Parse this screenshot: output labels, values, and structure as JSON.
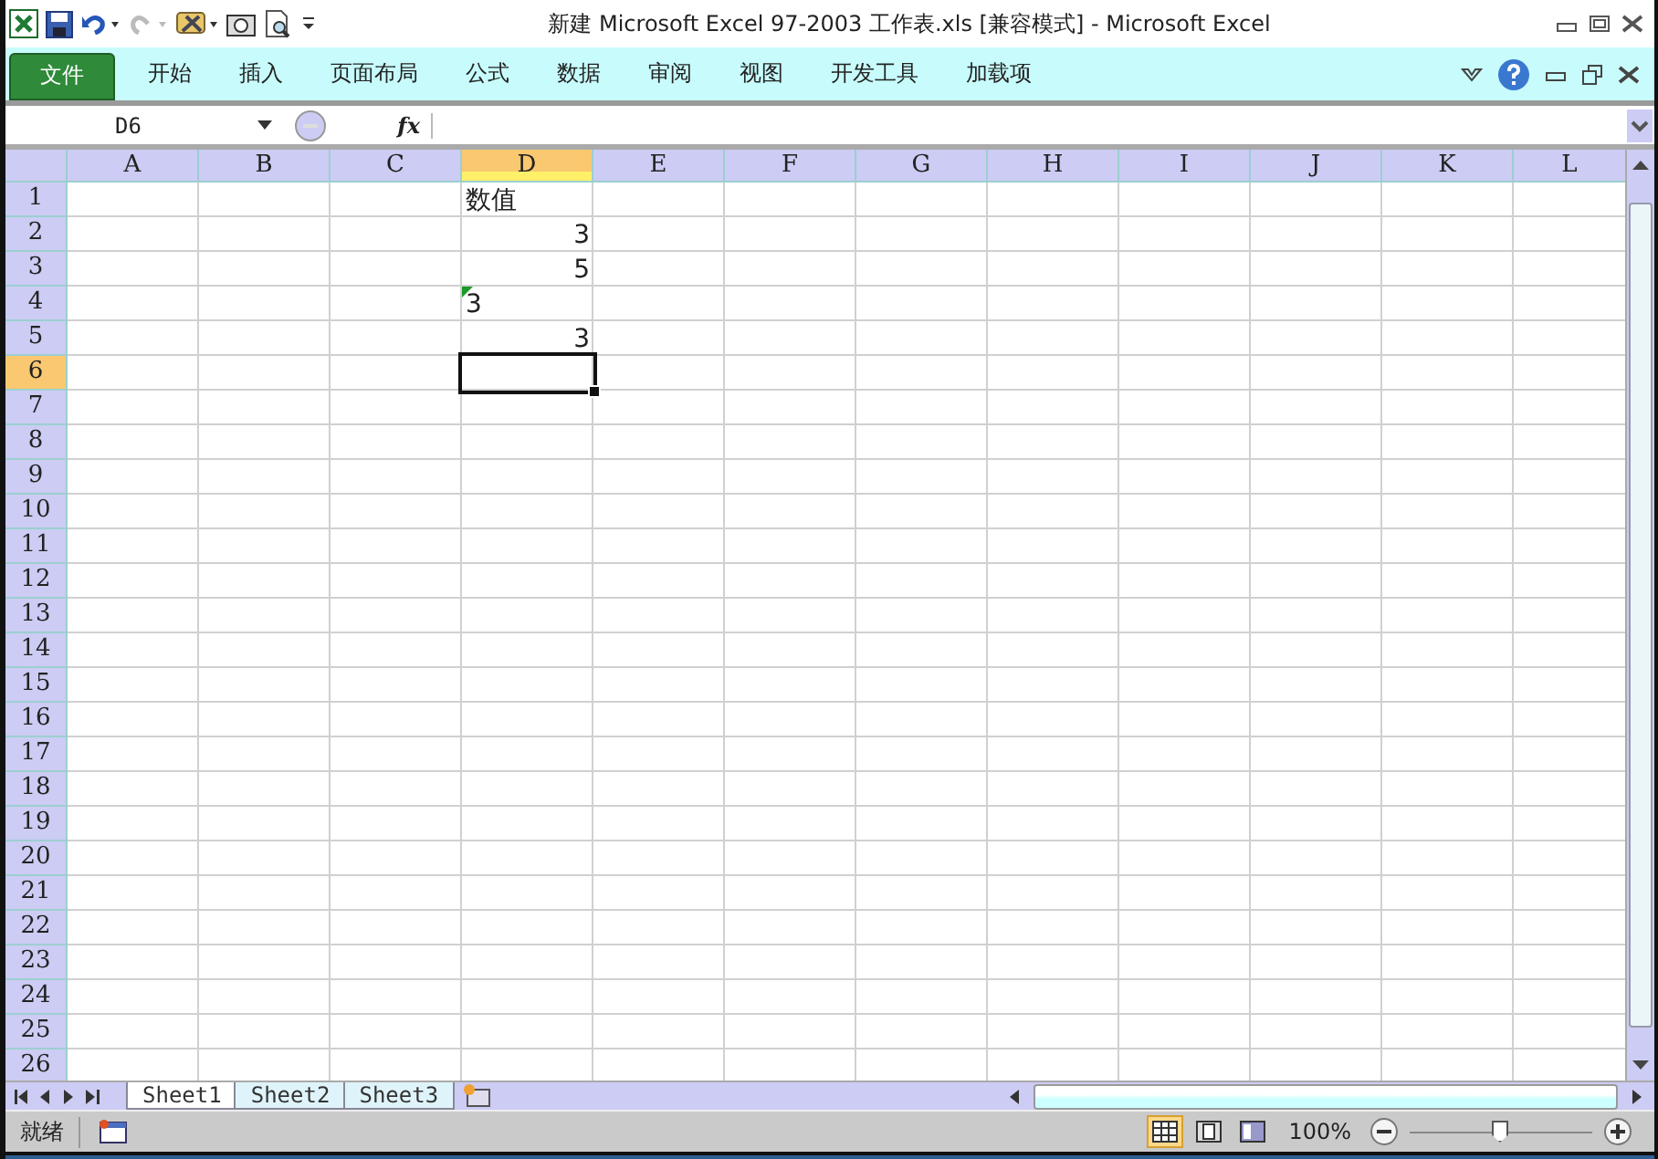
{
  "window": {
    "title": "新建 Microsoft Excel 97-2003 工作表.xls  [兼容模式]  -  Microsoft Excel"
  },
  "ribbon": {
    "file_tab": "文件",
    "tabs": [
      {
        "label": "开始",
        "selected": false
      },
      {
        "label": "插入",
        "selected": false
      },
      {
        "label": "页面布局",
        "selected": false
      },
      {
        "label": "公式",
        "selected": false
      },
      {
        "label": "数据",
        "selected": false
      },
      {
        "label": "审阅",
        "selected": false
      },
      {
        "label": "视图",
        "selected": false
      },
      {
        "label": "开发工具",
        "selected": false
      },
      {
        "label": "加载项",
        "selected": false
      }
    ]
  },
  "formula_bar": {
    "name_box": "D6",
    "fx": "fx"
  },
  "grid": {
    "columns": [
      {
        "label": "A",
        "selected": false
      },
      {
        "label": "B",
        "selected": false
      },
      {
        "label": "C",
        "selected": false
      },
      {
        "label": "D",
        "selected": true
      },
      {
        "label": "E",
        "selected": false
      },
      {
        "label": "F",
        "selected": false
      },
      {
        "label": "G",
        "selected": false
      },
      {
        "label": "H",
        "selected": false
      },
      {
        "label": "I",
        "selected": false
      },
      {
        "label": "J",
        "selected": false
      },
      {
        "label": "K",
        "selected": false
      },
      {
        "label": "L",
        "selected": false
      }
    ],
    "rows": [
      {
        "label": "1",
        "selected": false,
        "cells": [
          null,
          null,
          null,
          {
            "text": "数值",
            "kind": "text",
            "error_flag": false
          }
        ]
      },
      {
        "label": "2",
        "selected": false,
        "cells": [
          null,
          null,
          null,
          {
            "text": "3",
            "kind": "number",
            "error_flag": false
          }
        ]
      },
      {
        "label": "3",
        "selected": false,
        "cells": [
          null,
          null,
          null,
          {
            "text": "5",
            "kind": "number",
            "error_flag": false
          }
        ]
      },
      {
        "label": "4",
        "selected": false,
        "cells": [
          null,
          null,
          null,
          {
            "text": "3",
            "kind": "text",
            "error_flag": true
          }
        ]
      },
      {
        "label": "5",
        "selected": false,
        "cells": [
          null,
          null,
          null,
          {
            "text": "3",
            "kind": "number",
            "error_flag": false
          }
        ]
      },
      {
        "label": "6",
        "selected": true,
        "cells": []
      },
      {
        "label": "7",
        "selected": false,
        "cells": []
      },
      {
        "label": "8",
        "selected": false,
        "cells": []
      },
      {
        "label": "9",
        "selected": false,
        "cells": []
      },
      {
        "label": "10",
        "selected": false,
        "cells": []
      },
      {
        "label": "11",
        "selected": false,
        "cells": []
      },
      {
        "label": "12",
        "selected": false,
        "cells": []
      },
      {
        "label": "13",
        "selected": false,
        "cells": []
      },
      {
        "label": "14",
        "selected": false,
        "cells": []
      },
      {
        "label": "15",
        "selected": false,
        "cells": []
      },
      {
        "label": "16",
        "selected": false,
        "cells": []
      },
      {
        "label": "17",
        "selected": false,
        "cells": []
      },
      {
        "label": "18",
        "selected": false,
        "cells": []
      },
      {
        "label": "19",
        "selected": false,
        "cells": []
      },
      {
        "label": "20",
        "selected": false,
        "cells": []
      },
      {
        "label": "21",
        "selected": false,
        "cells": []
      },
      {
        "label": "22",
        "selected": false,
        "cells": []
      },
      {
        "label": "23",
        "selected": false,
        "cells": []
      },
      {
        "label": "24",
        "selected": false,
        "cells": []
      },
      {
        "label": "25",
        "selected": false,
        "cells": []
      },
      {
        "label": "26",
        "selected": false,
        "cells": []
      }
    ]
  },
  "sheet_tabs": [
    {
      "label": "Sheet1",
      "selected": true
    },
    {
      "label": "Sheet2",
      "selected": false
    },
    {
      "label": "Sheet3",
      "selected": false
    }
  ],
  "status_bar": {
    "status": "就绪",
    "views": [
      {
        "kind": "normal",
        "selected": true
      },
      {
        "kind": "layout",
        "selected": false
      },
      {
        "kind": "pagebreak",
        "selected": false
      }
    ],
    "zoom": "100%",
    "zoom_slider": {
      "level": 0.5
    }
  }
}
